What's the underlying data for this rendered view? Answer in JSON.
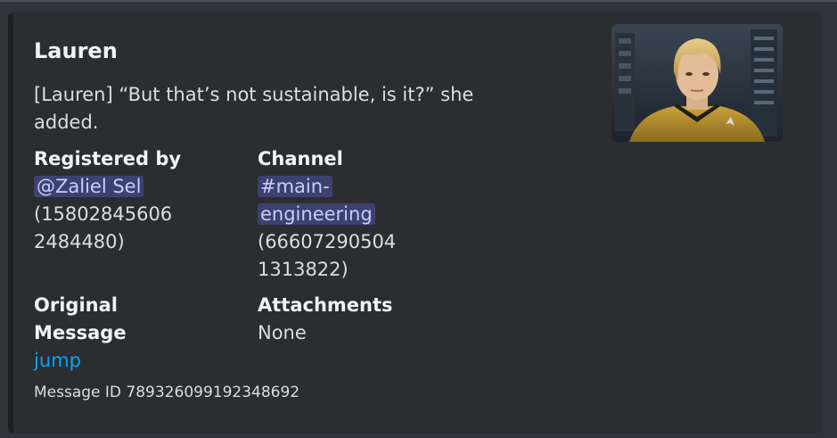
{
  "embed": {
    "author": "Lauren",
    "description": "[Lauren] “But that’s not sustainable, is it?” she added.",
    "fields": {
      "registered_by": {
        "name": "Registered by",
        "mention": "@Zaliel Sel",
        "id_line1": "(15802845606",
        "id_line2": "2484480)"
      },
      "channel": {
        "name": "Channel",
        "mention_line1": "#main-",
        "mention_line2": "engineering",
        "id_line1": "(66607290504",
        "id_line2": "1313822)"
      },
      "original_message": {
        "name_line1": "Original",
        "name_line2": "Message",
        "link": "jump"
      },
      "attachments": {
        "name": "Attachments",
        "value": "None"
      }
    },
    "footer": "Message ID 789326099192348692",
    "thumbnail": "character-portrait"
  },
  "colors": {
    "background": "#313338",
    "embed_background": "#2b2d31",
    "embed_border": "#1e1f22",
    "mention_bg": "#3c4270",
    "mention_text": "#c9cdfb",
    "link": "#00a8fc"
  }
}
